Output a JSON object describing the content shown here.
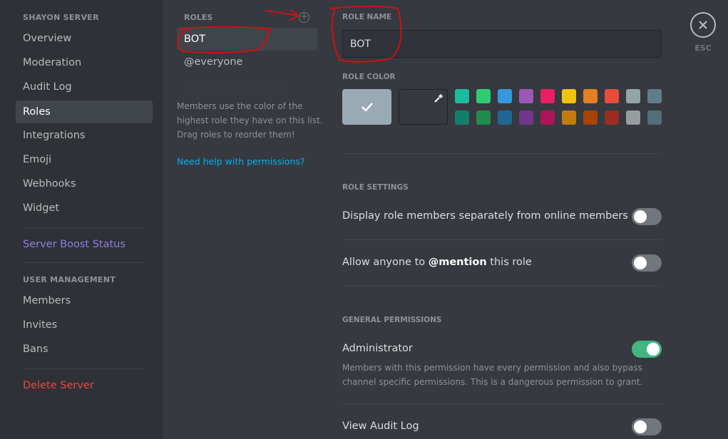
{
  "sidebar": {
    "header": "SHAYON SERVER",
    "items": [
      {
        "label": "Overview"
      },
      {
        "label": "Moderation"
      },
      {
        "label": "Audit Log"
      },
      {
        "label": "Roles"
      },
      {
        "label": "Integrations"
      },
      {
        "label": "Emoji"
      },
      {
        "label": "Webhooks"
      },
      {
        "label": "Widget"
      }
    ],
    "boost": "Server Boost Status",
    "user_mgmt_header": "USER MANAGEMENT",
    "user_items": [
      {
        "label": "Members"
      },
      {
        "label": "Invites"
      },
      {
        "label": "Bans"
      }
    ],
    "delete": "Delete Server"
  },
  "roles_panel": {
    "header": "ROLES",
    "add_icon": "plus-circle-icon",
    "roles": [
      {
        "label": "BOT",
        "selected": true
      },
      {
        "label": "@everyone",
        "selected": false
      }
    ],
    "help_text": "Members use the color of the highest role they have on this list. Drag roles to reorder them!",
    "help_link": "Need help with permissions?"
  },
  "main": {
    "role_name_label": "ROLE NAME",
    "role_name_value": "BOT",
    "role_color_label": "ROLE COLOR",
    "default_color": "#99aab5",
    "swatches_row1": [
      "#1abc9c",
      "#2ecc71",
      "#3498db",
      "#9b59b6",
      "#e91e63",
      "#f1c40f",
      "#e67e22",
      "#e74c3c",
      "#95a5a6",
      "#607d8b"
    ],
    "swatches_row2": [
      "#11806a",
      "#1f8b4c",
      "#206694",
      "#71368a",
      "#ad1457",
      "#c27c0e",
      "#a84300",
      "#992d22",
      "#979c9f",
      "#546e7a"
    ],
    "role_settings_label": "ROLE SETTINGS",
    "display_separately": {
      "label": "Display role members separately from online members",
      "on": false
    },
    "mention_prefix": "Allow anyone to ",
    "mention_bold": "@mention",
    "mention_suffix": " this role",
    "mention_on": false,
    "general_permissions_label": "GENERAL PERMISSIONS",
    "administrator": {
      "label": "Administrator",
      "on": true,
      "desc": "Members with this permission have every permission and also bypass channel specific permissions. This is a dangerous permission to grant."
    },
    "view_audit_log": {
      "label": "View Audit Log",
      "on": false
    }
  },
  "close": {
    "icon": "close-icon",
    "label": "ESC"
  },
  "colors": {
    "accent_link": "#00b0f4",
    "toggle_on": "#43b581",
    "danger": "#f04747",
    "annotation": "#d01010"
  }
}
